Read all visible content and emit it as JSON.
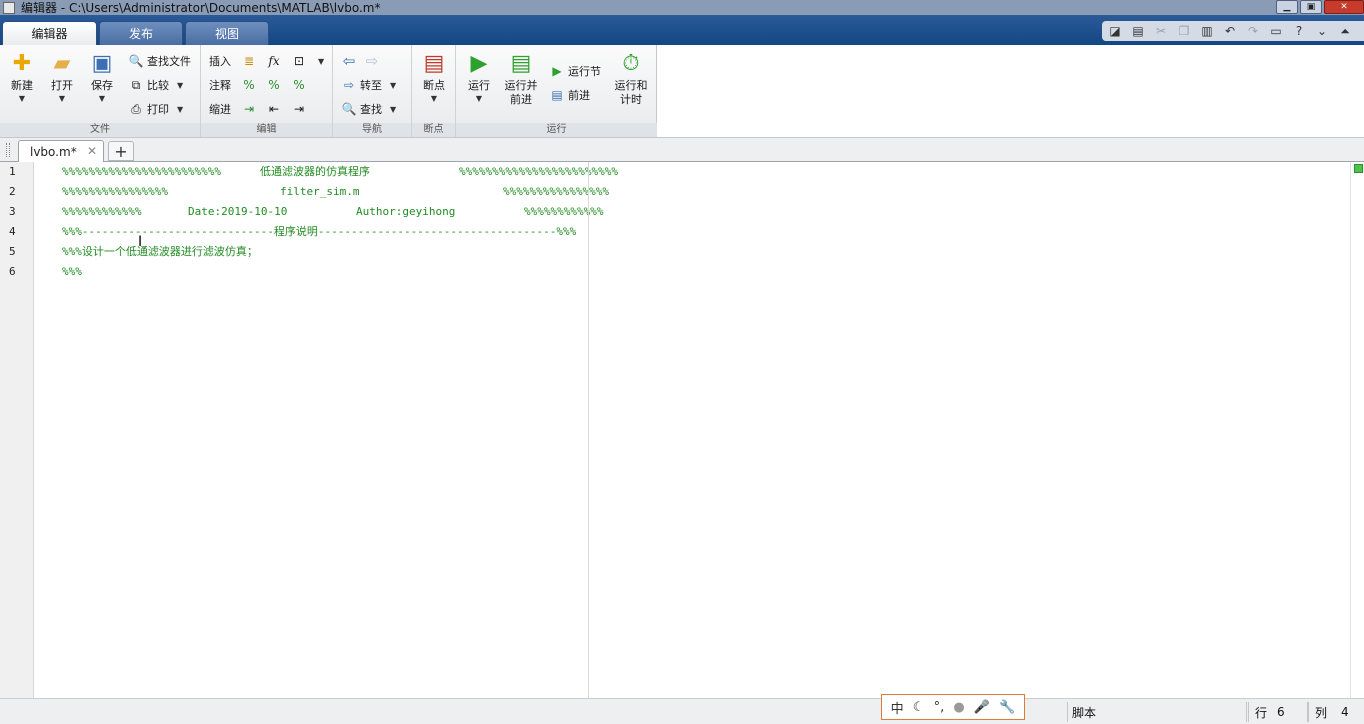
{
  "window": {
    "title": "编辑器 - C:\\Users\\Administrator\\Documents\\MATLAB\\lvbo.m*"
  },
  "ribbon_tabs": [
    {
      "label": "编辑器",
      "active": true
    },
    {
      "label": "发布",
      "active": false
    },
    {
      "label": "视图",
      "active": false
    }
  ],
  "ribbon": {
    "file": {
      "group_label": "文件",
      "new_label": "新建",
      "open_label": "打开",
      "save_label": "保存",
      "find_files_label": "查找文件",
      "compare_label": "比较",
      "print_label": "打印"
    },
    "edit": {
      "group_label": "编辑",
      "insert_label": "插入",
      "comment_label": "注释",
      "indent_label": "缩进",
      "fx_label": "fx"
    },
    "navigate": {
      "group_label": "导航",
      "goto_label": "转至",
      "find_label": "查找"
    },
    "breakpoints": {
      "group_label": "断点",
      "breakpoints_label": "断点"
    },
    "run": {
      "group_label": "运行",
      "run_label": "运行",
      "run_advance_line1": "运行并",
      "run_advance_line2": "前进",
      "run_section_label": "运行节",
      "advance_label": "前进",
      "run_time_line1": "运行和",
      "run_time_line2": "计时"
    }
  },
  "document_tab": {
    "filename": "lvbo.m*",
    "close_glyph": "✕",
    "add_glyph": "+"
  },
  "editor": {
    "lines": [
      {
        "num": "1",
        "segments": [
          {
            "text": "%%%%%%%%%%%%%%%%%%%%%%%%"
          },
          {
            "text": "低通滤波器的仿真程序"
          },
          {
            "text": "%%%%%%%%%%%%%%%%%%%%%%%%"
          }
        ]
      },
      {
        "num": "2",
        "segments": [
          {
            "text": "%%%%%%%%%%%%%%%%"
          },
          {
            "text": "filter_sim.m"
          },
          {
            "text": "%%%%%%%%%%%%%%%%"
          }
        ]
      },
      {
        "num": "3",
        "segments": [
          {
            "text": "%%%%%%%%%%%%"
          },
          {
            "text": "Date:2019-10-10"
          },
          {
            "text": "Author:geyihong"
          },
          {
            "text": "%%%%%%%%%%%%"
          }
        ]
      },
      {
        "num": "4",
        "segments": [
          {
            "text": "%%%-----------------------------程序说明------------------------------------%%%"
          }
        ]
      },
      {
        "num": "5",
        "segments": [
          {
            "text": "%%%设计一个低通滤波器进行滤波仿真；"
          }
        ]
      },
      {
        "num": "6",
        "segments": [
          {
            "text": "%%%"
          }
        ]
      }
    ]
  },
  "ime_bar": {
    "mode": "中",
    "icons": [
      "moon-icon",
      "punctuation-icon",
      "user-icon",
      "microphone-icon",
      "wrench-icon"
    ]
  },
  "status": {
    "file_type": "脚本",
    "line_label": "行",
    "line_value": "6",
    "col_label": "列",
    "col_value": "4"
  },
  "colors": {
    "comment_green": "#228b22",
    "ribbon_blue": "#154684",
    "line_number": "#222222"
  }
}
